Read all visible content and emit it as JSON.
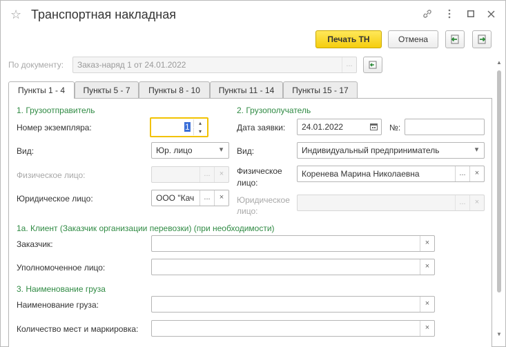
{
  "window": {
    "title": "Транспортная накладная"
  },
  "toolbar": {
    "print_label": "Печать ТН",
    "cancel_label": "Отмена"
  },
  "document": {
    "label": "По документу:",
    "value": "Заказ-наряд 1 от 24.01.2022",
    "select_glyph": "..."
  },
  "tabs": [
    {
      "label": "Пункты 1 - 4",
      "active": true
    },
    {
      "label": "Пункты 5 - 7",
      "active": false
    },
    {
      "label": "Пункты 8 - 10",
      "active": false
    },
    {
      "label": "Пункты 11 - 14",
      "active": false
    },
    {
      "label": "Пункты 15 - 17",
      "active": false
    }
  ],
  "sender": {
    "header": "1. Грузоотправитель",
    "copy_number_label": "Номер экземпляра:",
    "copy_number_value": "1",
    "type_label": "Вид:",
    "type_value": "Юр. лицо",
    "person_label": "Физическое лицо:",
    "person_value": "",
    "legal_label": "Юридическое лицо:",
    "legal_value": "ООО \"Кач"
  },
  "receiver": {
    "header": "2. Грузополучатель",
    "date_label": "Дата заявки:",
    "date_value": "24.01.2022",
    "number_label": "№:",
    "number_value": "",
    "type_label": "Вид:",
    "type_value": "Индивидуальный предприниматель",
    "person_label_1": "Физическое",
    "person_label_2": "лицо:",
    "person_value": "Коренева Марина Николаевна",
    "legal_label_1": "Юридическое",
    "legal_label_2": "лицо:",
    "legal_value": ""
  },
  "client": {
    "header": "1а. Клиент (Заказчик организации перевозки) (при необходимости)",
    "customer_label": "Заказчик:",
    "customer_value": "",
    "agent_label": "Уполномоченное лицо:",
    "agent_value": ""
  },
  "cargo": {
    "header": "3. Наименование груза",
    "name_label": "Наименование груза:",
    "name_value": "",
    "qty_label": "Количество мест и маркировка:",
    "qty_value": ""
  },
  "glyphs": {
    "ellipsis": "...",
    "clear": "×",
    "dropdown": "▾",
    "calendar": "▦",
    "spin_up": "▴",
    "spin_down": "▾"
  },
  "colors": {
    "section": "#2f8a43",
    "primary_button": "#f5cd0d",
    "focus": "#f2c200"
  }
}
